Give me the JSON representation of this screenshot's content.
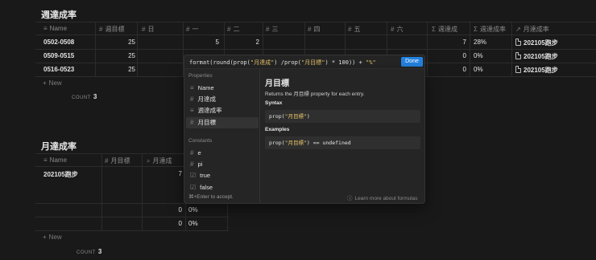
{
  "table1": {
    "title": "週達成率",
    "headers": [
      "Name",
      "週目標",
      "日",
      "一",
      "二",
      "三",
      "四",
      "五",
      "六",
      "週達成",
      "週達成率",
      "月達成率"
    ],
    "header_icons": [
      "text-icon",
      "hash-icon",
      "hash-icon",
      "hash-icon",
      "hash-icon",
      "hash-icon",
      "hash-icon",
      "hash-icon",
      "hash-icon",
      "sigma-icon",
      "sigma-icon",
      "relation-arrow-icon"
    ],
    "rows": [
      {
        "name": "0502-0508",
        "goal": "25",
        "mon": "5",
        "tue": "2",
        "total": "7",
        "rate": "28%",
        "month": "202105跑步"
      },
      {
        "name": "0509-0515",
        "goal": "25",
        "mon": "",
        "tue": "",
        "total": "0",
        "rate": "0%",
        "month": "202105跑步"
      },
      {
        "name": "0516-0523",
        "goal": "25",
        "mon": "",
        "tue": "",
        "total": "0",
        "rate": "0%",
        "month": "202105跑步"
      }
    ],
    "new_label": "New",
    "count_label": "COUNT",
    "count_value": "3"
  },
  "table2": {
    "title": "月達成率",
    "headers": [
      "Name",
      "月目標",
      "月達成"
    ],
    "header_icons": [
      "text-icon",
      "hash-icon",
      "search-icon"
    ],
    "rows": [
      {
        "name": "202105跑步",
        "goal": "",
        "total": "7",
        "rate": ""
      },
      {
        "name": "",
        "goal": "",
        "total": "0",
        "rate": "0%"
      },
      {
        "name": "",
        "goal": "",
        "total": "0",
        "rate": "0%"
      }
    ],
    "new_label": "New",
    "count_label": "COUNT",
    "count_value": "3"
  },
  "formula": {
    "done_label": "Done",
    "properties_label": "Properties",
    "properties": [
      {
        "label": "Name",
        "icon": "text-icon"
      },
      {
        "label": "月達成",
        "icon": "hash-icon"
      },
      {
        "label": "週達成率",
        "icon": "text-icon"
      },
      {
        "label": "月目標",
        "icon": "hash-icon"
      }
    ],
    "constants_label": "Constants",
    "constants": [
      {
        "label": "e",
        "icon": "hash-icon"
      },
      {
        "label": "pi",
        "icon": "hash-icon"
      },
      {
        "label": "true",
        "icon": "checkbox-icon"
      },
      {
        "label": "false",
        "icon": "checkbox-icon"
      }
    ],
    "hint": "⌘+Enter to accept.",
    "detail_title": "月目標",
    "detail_desc": "Returns the 月目標 property for each entry.",
    "syntax_label": "Syntax",
    "syntax_code": "prop(\"月目標\")",
    "examples_label": "Examples",
    "example_code": "prop(\"月目標\") == undefined",
    "learn_more": "Learn more about formulas"
  }
}
